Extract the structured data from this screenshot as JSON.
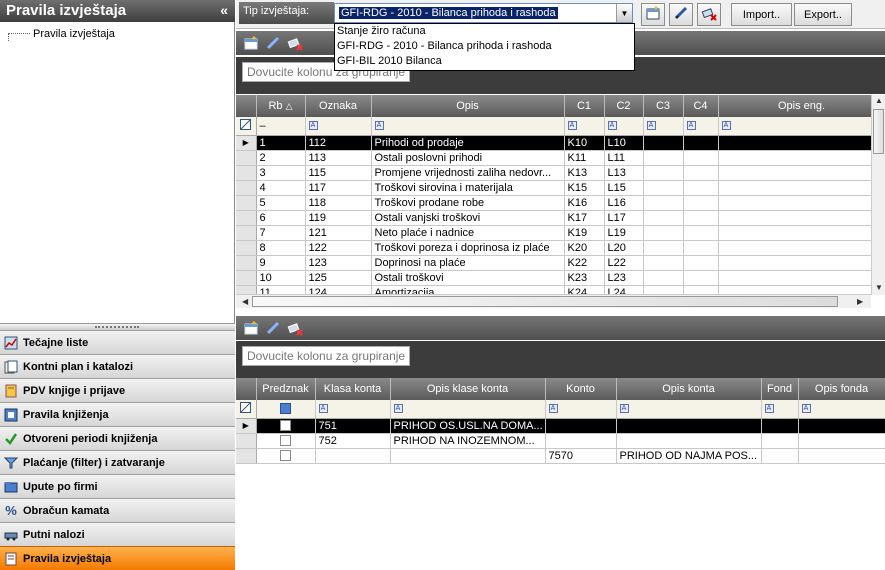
{
  "sidebar": {
    "title": "Pravila izvještaja",
    "collapse_label": "«",
    "tree_item": "Pravila izvještaja",
    "nav": [
      {
        "label": "Tečajne liste",
        "icon": "chart-icon"
      },
      {
        "label": "Kontni plan i katalozi",
        "icon": "catalog-icon"
      },
      {
        "label": "PDV knjige i prijave",
        "icon": "tax-book-icon"
      },
      {
        "label": "Pravila knjiženja",
        "icon": "rules-icon"
      },
      {
        "label": "Otvoreni periodi knjiženja",
        "icon": "checkmark-icon"
      },
      {
        "label": "Plaćanje (filter) i zatvaranje",
        "icon": "filter-icon"
      },
      {
        "label": "Upute po firmi",
        "icon": "folder-icon"
      },
      {
        "label": "Obračun kamata",
        "icon": "percent-icon"
      },
      {
        "label": "Putni nalozi",
        "icon": "car-icon"
      },
      {
        "label": "Pravila izvještaja",
        "icon": "report-icon"
      }
    ]
  },
  "toolbar": {
    "tip_label": "Tip izvještaja:",
    "tip_value": "GFI-RDG - 2010 - Bilanca prihoda i rashoda",
    "import_label": "Import..",
    "export_label": "Export.."
  },
  "dropdown": {
    "options": [
      "Stanje žiro računa",
      "GFI-RDG - 2010 - Bilanca prihoda i rashoda",
      "GFI-BIL 2010 Bilanca"
    ]
  },
  "grid1": {
    "group_placeholder": "Dovucite kolonu za grupiranje",
    "headers": [
      "Rb",
      "Oznaka",
      "Opis",
      "C1",
      "C2",
      "C3",
      "C4",
      "Opis eng."
    ],
    "filter_dash": "–",
    "rows": [
      [
        "1",
        "112",
        "Prihodi od prodaje",
        "K10",
        "L10",
        "",
        "",
        ""
      ],
      [
        "2",
        "113",
        "Ostali poslovni prihodi",
        "K11",
        "L11",
        "",
        "",
        ""
      ],
      [
        "3",
        "115",
        "Promjene  vrijednosti zaliha  nedovr...",
        "K13",
        "L13",
        "",
        "",
        ""
      ],
      [
        "4",
        "117",
        "Troškovi sirovina i materijala",
        "K15",
        "L15",
        "",
        "",
        ""
      ],
      [
        "5",
        "118",
        "Troškovi prodane robe",
        "K16",
        "L16",
        "",
        "",
        ""
      ],
      [
        "6",
        "119",
        "Ostali vanjski troškovi",
        "K17",
        "L17",
        "",
        "",
        ""
      ],
      [
        "7",
        "121",
        "Neto plaće i nadnice",
        "K19",
        "L19",
        "",
        "",
        ""
      ],
      [
        "8",
        "122",
        "Troškovi poreza i doprinosa iz plaće",
        "K20",
        "L20",
        "",
        "",
        ""
      ],
      [
        "9",
        "123",
        "Doprinosi na plaće",
        "K22",
        "L22",
        "",
        "",
        ""
      ],
      [
        "10",
        "125",
        "Ostali troškovi",
        "K23",
        "L23",
        "",
        "",
        ""
      ],
      [
        "11",
        "124",
        "Amortizacija",
        "K24",
        "L24",
        "",
        "",
        ""
      ]
    ]
  },
  "grid2": {
    "group_placeholder": "Dovucite kolonu za grupiranje",
    "headers": [
      "Predznak",
      "Klasa konta",
      "Opis klase konta",
      "Konto",
      "Opis konta",
      "Fond",
      "Opis fonda"
    ],
    "rows": [
      [
        "",
        "751",
        "PRIHOD  OS.USL.NA  DOMA...",
        "",
        "",
        "",
        ""
      ],
      [
        "",
        "752",
        "PRIHOD  NA  INOZEMNOM...",
        "",
        "",
        "",
        ""
      ],
      [
        "",
        "",
        "",
        "7570",
        "PRIHOD  OD NAJMA POS...",
        "",
        ""
      ]
    ]
  }
}
